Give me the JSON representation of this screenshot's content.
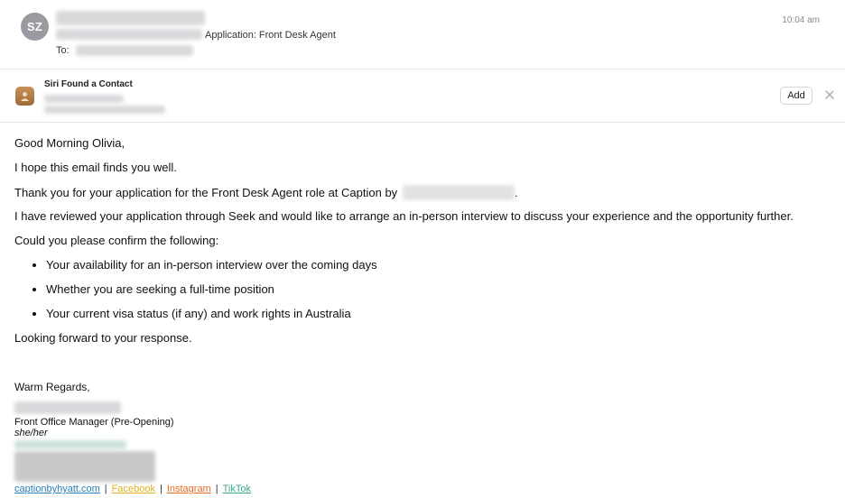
{
  "header": {
    "avatar_initials": "SZ",
    "subject": "Application: Front Desk Agent",
    "to_label": "To:",
    "time": "10:04 am"
  },
  "siri": {
    "title": "Siri Found a Contact",
    "add_label": "Add",
    "close_icon": "close-icon"
  },
  "body": {
    "greeting": "Good Morning Olivia,",
    "line1": "I hope this email finds you well.",
    "line2_prefix": "Thank you for your application for the Front Desk Agent role at Caption by",
    "line2_suffix": ".",
    "line3": "I have reviewed your application through Seek and would like to arrange an in-person interview to discuss your experience and the opportunity further.",
    "line4": "Could you please confirm the following:",
    "bullets": [
      "Your availability for an in-person interview over the coming days",
      "Whether you are seeking a full-time position",
      "Your current visa status (if any) and work rights in Australia"
    ],
    "closing_line": "Looking forward to your response."
  },
  "signature": {
    "regards": "Warm Regards,",
    "role": "Front Office Manager (Pre-Opening)",
    "pronouns": "she/her",
    "links": [
      {
        "label": "captionbyhyatt.com",
        "color": "#2a7fb8"
      },
      {
        "label": "Facebook",
        "color": "#e0b31c"
      },
      {
        "label": "Instagram",
        "color": "#e26b22"
      },
      {
        "label": "TikTok",
        "color": "#3aa98c"
      }
    ],
    "separator": "|"
  }
}
